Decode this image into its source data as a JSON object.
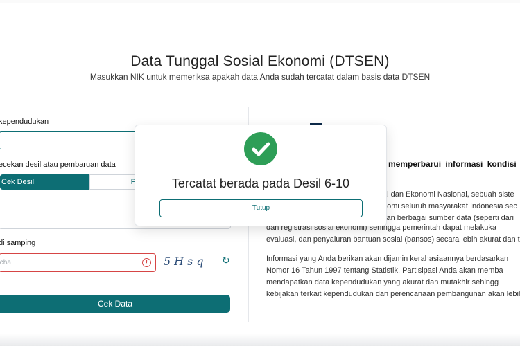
{
  "header": {
    "title": "Data Tunggal Sosial Ekonomi (DTSEN)",
    "subtitle": "Masukkan NIK untuk memeriksa apakah data Anda sudah tercatat dalam basis data DTSEN"
  },
  "form": {
    "nik_label": "kependudukan",
    "check_type_label": "ecekan desil atau pembaruan data",
    "segment_active": "Cek Desil",
    "segment_inactive": "P",
    "captcha_label": "di samping",
    "captcha_placeholder": "tcha",
    "captcha_text": "5Hsq",
    "submit_label": "Cek Data"
  },
  "info": {
    "heading": "memperbarui informasi kondisi s",
    "lines": [
      "al dan Ekonomi Nasional, sebuah siste",
      "nomi seluruh masyarakat Indonesia sec",
      "kan berbagai sumber data (seperti dari",
      "dan registrasi sosial ekonomi) sehingga pemerintah dapat melakuka",
      "evaluasi, dan penyaluran bantuan sosial (bansos) secara lebih akurat dan t",
      "Informasi yang Anda berikan akan dijamin kerahasiaannya berdasarkan",
      "Nomor 16 Tahun 1997 tentang Statistik. Partisipasi Anda akan memba",
      "mendapatkan data kependudukan yang akurat dan mutakhir sehingg",
      "kebijakan terkait kependudukan dan perencanaan pembangunan akan lebih"
    ]
  },
  "modal": {
    "message": "Tercatat berada pada Desil 6-10",
    "close_label": "Tutup"
  },
  "colors": {
    "primary": "#0d6e74",
    "success": "#2e9e57",
    "error": "#d64545"
  },
  "icons": [
    "check-icon",
    "error-icon",
    "refresh-icon"
  ]
}
